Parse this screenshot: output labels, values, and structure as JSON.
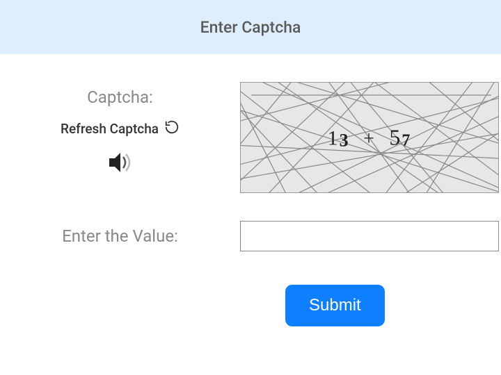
{
  "header": {
    "title": "Enter Captcha"
  },
  "captcha": {
    "label": "Captcha:",
    "refresh_label": "Refresh Captcha",
    "expression": "13 + 57",
    "d1": "1",
    "d2": "3",
    "plus": "+",
    "d3": "5",
    "d4": "7"
  },
  "value_field": {
    "label": "Enter the Value:",
    "value": ""
  },
  "submit": {
    "label": "Submit"
  },
  "colors": {
    "header_bg": "#dfeefd",
    "submit_bg": "#0d7fff"
  }
}
